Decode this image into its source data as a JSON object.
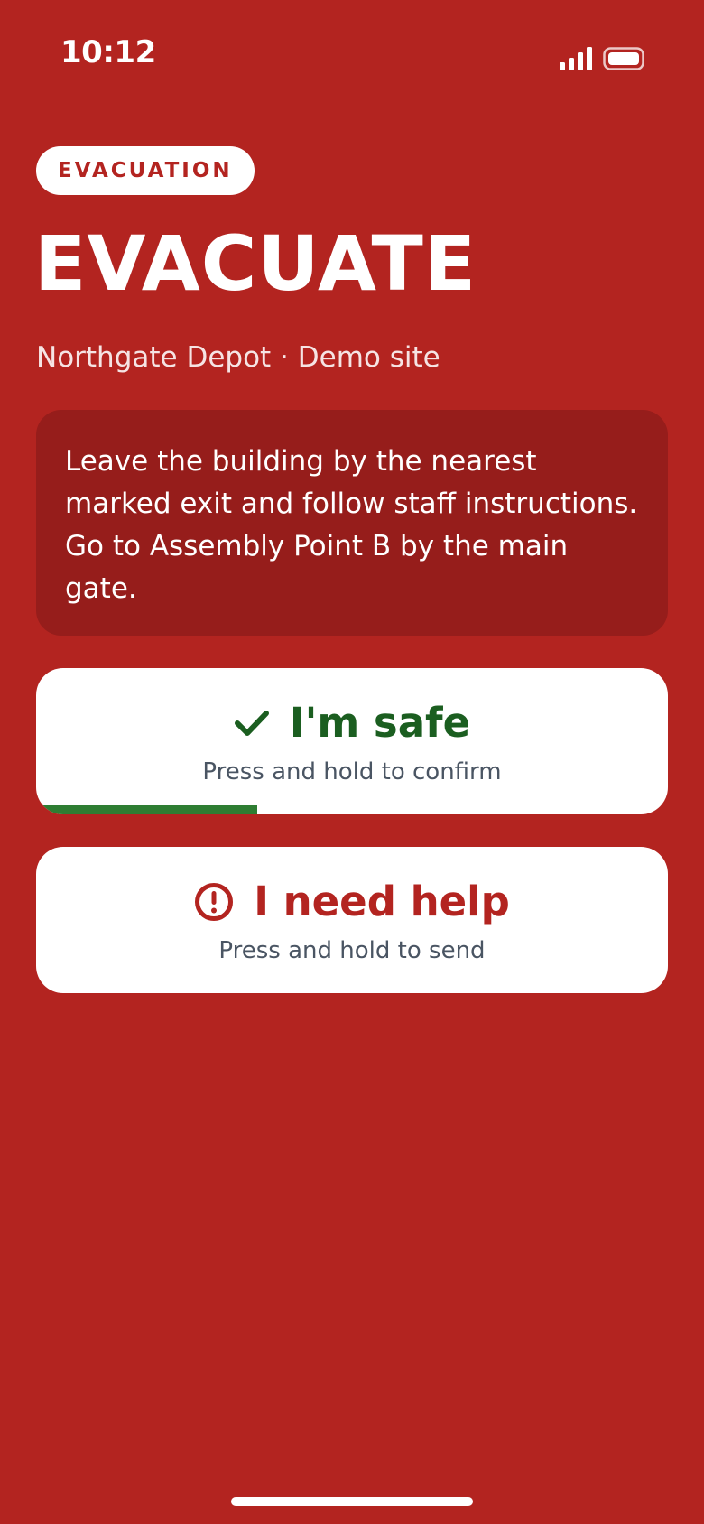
{
  "status_bar": {
    "time": "10:12",
    "signal_icon": "cellular-signal-icon",
    "battery_icon": "battery-icon"
  },
  "alert": {
    "badge": "EVACUATION",
    "title": "EVACUATE",
    "site": "Northgate Depot · Demo site",
    "instructions": "Leave the building by the nearest marked exit and follow staff instructions. Go to Assembly Point B by the main gate."
  },
  "actions": {
    "safe": {
      "icon": "checkmark-icon",
      "label": "I'm safe",
      "hint": "Press and hold to confirm",
      "hold_progress": 0.35
    },
    "help": {
      "icon": "exclamation-circle-icon",
      "label": "I need help",
      "hint": "Press and hold to send"
    }
  },
  "colors": {
    "background": "#b32420",
    "card_dark": "#961d1b",
    "safe_green": "#1b5e20",
    "progress_green": "#2e7d32",
    "help_red": "#b32420",
    "hint_gray": "#4a5563"
  }
}
